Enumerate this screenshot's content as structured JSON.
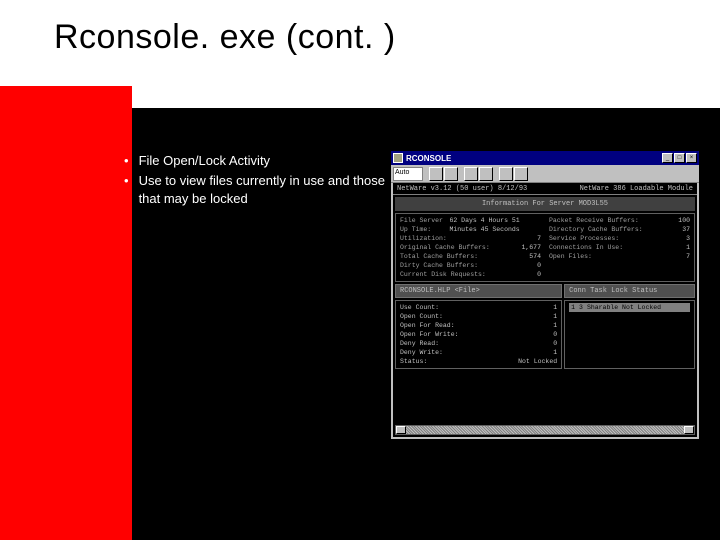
{
  "title": "Rconsole. exe (cont. )",
  "bullets": [
    "File Open/Lock Activity",
    "Use to view files currently in use and those that may be locked"
  ],
  "window": {
    "title": "RCONSOLE",
    "toolbar_sel": "Auto",
    "header_left": "NetWare v3.12 (50 user)  8/12/93",
    "header_right": "NetWare 386 Loadable Module",
    "info_title": "Information For Server MOD3L55",
    "stats_left": [
      {
        "label": "File Server Up Time:",
        "val": "62 Days 4 Hours 51 Minutes 45 Seconds"
      },
      {
        "label": "Utilization:",
        "val": "7"
      },
      {
        "label": "Original Cache Buffers:",
        "val": "1,677"
      },
      {
        "label": "Total Cache Buffers:",
        "val": "574"
      },
      {
        "label": "Dirty Cache Buffers:",
        "val": "0"
      },
      {
        "label": "Current Disk Requests:",
        "val": "0"
      }
    ],
    "stats_right": [
      {
        "label": "Packet Receive Buffers:",
        "val": "100"
      },
      {
        "label": "Directory Cache Buffers:",
        "val": "37"
      },
      {
        "label": "Service Processes:",
        "val": "3"
      },
      {
        "label": "Connections In Use:",
        "val": "1"
      },
      {
        "label": "Open Files:",
        "val": "7"
      }
    ],
    "bar_left": "RCONSOLE.HLP    <File>",
    "bar_right": "Conn Task  Lock Status",
    "file_stats": [
      {
        "label": "Use Count:",
        "val": "1"
      },
      {
        "label": "Open Count:",
        "val": "1"
      },
      {
        "label": "Open For Read:",
        "val": "1"
      },
      {
        "label": "Open For Write:",
        "val": "0"
      },
      {
        "label": "Deny Read:",
        "val": "0"
      },
      {
        "label": "Deny Write:",
        "val": "1"
      },
      {
        "label": "Status:",
        "val": "Not Locked"
      }
    ],
    "lock_row": {
      "conn": "1",
      "task": "3",
      "status": "Sharable  Not Locked"
    }
  }
}
